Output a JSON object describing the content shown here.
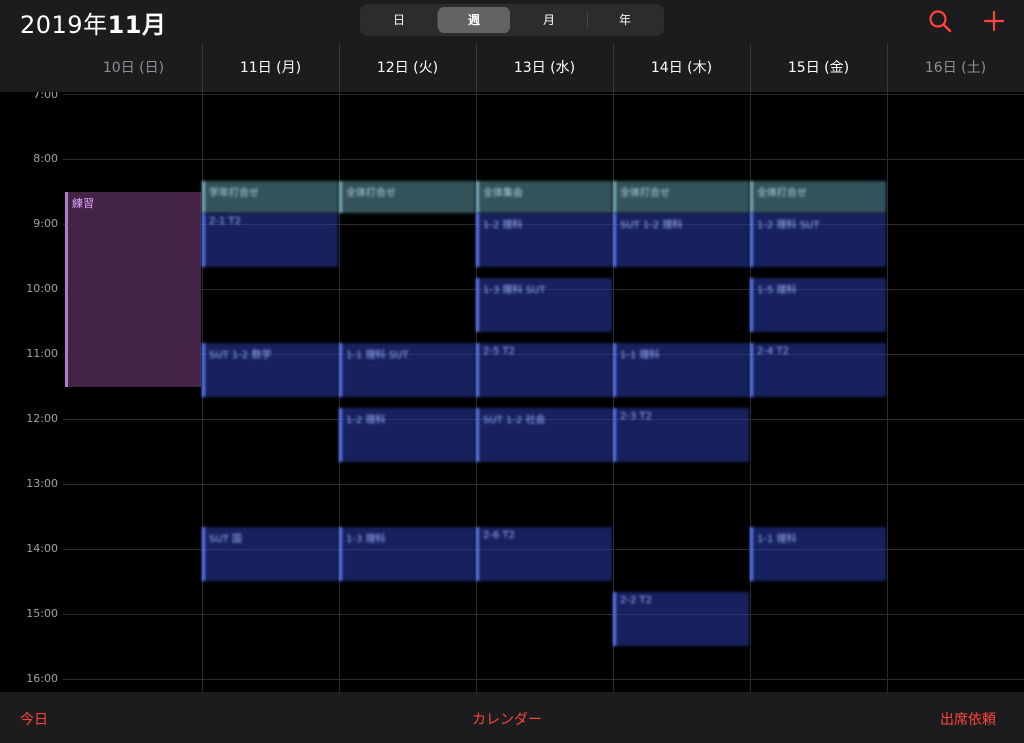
{
  "header": {
    "year_text": "2019年",
    "month_text": "11月",
    "segments": [
      {
        "label": "日",
        "selected": false
      },
      {
        "label": "週",
        "selected": true
      },
      {
        "label": "月",
        "selected": false
      },
      {
        "label": "年",
        "selected": false
      }
    ],
    "search_icon": "search-icon",
    "add_icon": "plus-icon",
    "accent_color": "#ff453a"
  },
  "days": [
    {
      "label": "10日 (日)",
      "dim": true
    },
    {
      "label": "11日 (月)",
      "dim": false
    },
    {
      "label": "12日 (火)",
      "dim": false
    },
    {
      "label": "13日 (水)",
      "dim": false
    },
    {
      "label": "14日 (木)",
      "dim": false
    },
    {
      "label": "15日 (金)",
      "dim": false
    },
    {
      "label": "16日 (土)",
      "dim": true
    }
  ],
  "times": [
    "7:00",
    "8:00",
    "9:00",
    "10:00",
    "11:00",
    "12:00",
    "13:00",
    "14:00",
    "15:00",
    "16:00"
  ],
  "events": [
    {
      "day": 0,
      "start": "8:30",
      "end": "11:30",
      "title": "練習",
      "color": "purple"
    },
    {
      "day": 1,
      "start": "8:20",
      "end": "8:50",
      "title": "学年打合せ",
      "color": "teal"
    },
    {
      "day": 1,
      "start": "8:50",
      "end": "9:40",
      "title": "2-1 T2",
      "color": "blue"
    },
    {
      "day": 1,
      "start": "10:50",
      "end": "11:40",
      "title": "SUT 1-2 数学",
      "color": "blue"
    },
    {
      "day": 1,
      "start": "13:40",
      "end": "14:30",
      "title": "SUT 国",
      "color": "blue"
    },
    {
      "day": 2,
      "start": "8:20",
      "end": "8:50",
      "title": "全体打合せ",
      "color": "teal"
    },
    {
      "day": 2,
      "start": "10:50",
      "end": "11:40",
      "title": "1-1 理科 SUT",
      "color": "blue"
    },
    {
      "day": 2,
      "start": "11:50",
      "end": "12:40",
      "title": "1-2 理科",
      "color": "blue"
    },
    {
      "day": 2,
      "start": "13:40",
      "end": "14:30",
      "title": "1-3 理科",
      "color": "blue"
    },
    {
      "day": 3,
      "start": "8:20",
      "end": "8:50",
      "title": "全体集会",
      "color": "teal"
    },
    {
      "day": 3,
      "start": "8:50",
      "end": "9:40",
      "title": "1-2 理科",
      "color": "blue"
    },
    {
      "day": 3,
      "start": "9:50",
      "end": "10:40",
      "title": "1-3 理科 SUT",
      "color": "blue"
    },
    {
      "day": 3,
      "start": "10:50",
      "end": "11:40",
      "title": "2-5 T2",
      "color": "blue"
    },
    {
      "day": 3,
      "start": "11:50",
      "end": "12:40",
      "title": "SUT 1-2 社会",
      "color": "blue"
    },
    {
      "day": 3,
      "start": "13:40",
      "end": "14:30",
      "title": "2-6 T2",
      "color": "blue"
    },
    {
      "day": 4,
      "start": "8:20",
      "end": "8:50",
      "title": "全体打合せ",
      "color": "teal"
    },
    {
      "day": 4,
      "start": "8:50",
      "end": "9:40",
      "title": "SUT 1-2 理科",
      "color": "blue"
    },
    {
      "day": 4,
      "start": "10:50",
      "end": "11:40",
      "title": "1-1 理科",
      "color": "blue"
    },
    {
      "day": 4,
      "start": "11:50",
      "end": "12:40",
      "title": "2-3 T2",
      "color": "blue"
    },
    {
      "day": 4,
      "start": "14:40",
      "end": "15:30",
      "title": "2-2 T2",
      "color": "blue"
    },
    {
      "day": 5,
      "start": "8:20",
      "end": "8:50",
      "title": "全体打合せ",
      "color": "teal"
    },
    {
      "day": 5,
      "start": "8:50",
      "end": "9:40",
      "title": "1-2 理科 SUT",
      "color": "blue"
    },
    {
      "day": 5,
      "start": "9:50",
      "end": "10:40",
      "title": "1-5 理科",
      "color": "blue"
    },
    {
      "day": 5,
      "start": "10:50",
      "end": "11:40",
      "title": "2-4 T2",
      "color": "blue"
    },
    {
      "day": 5,
      "start": "13:40",
      "end": "14:30",
      "title": "1-1 理科",
      "color": "blue"
    }
  ],
  "footer": {
    "today": "今日",
    "calendars": "カレンダー",
    "inbox": "出席依頼"
  }
}
